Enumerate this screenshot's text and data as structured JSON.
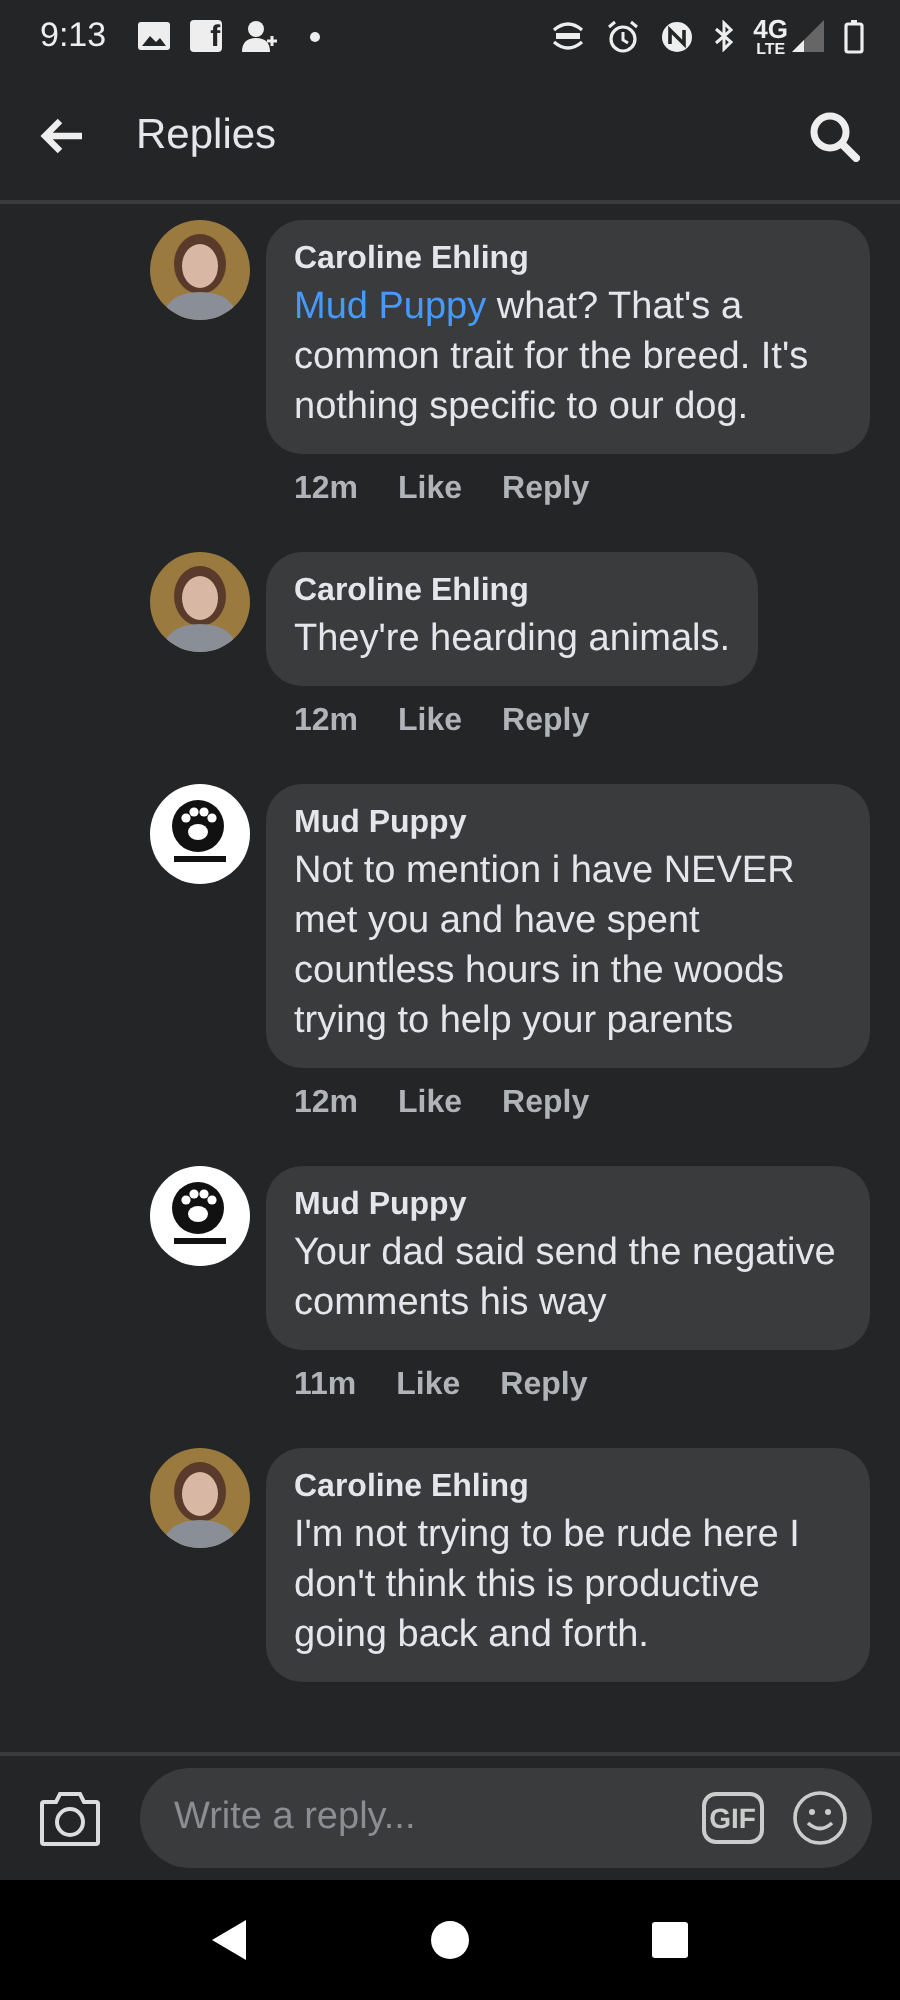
{
  "status_bar": {
    "time": "9:13",
    "notification_letter": "f",
    "network": "4G",
    "network_sub": "LTE"
  },
  "header": {
    "title": "Replies"
  },
  "comments": [
    {
      "author": "Caroline Ehling",
      "kind": "person",
      "mention": "Mud Puppy",
      "text": " what? That's a common trait for the breed. It's nothing specific to our dog.",
      "time": "12m",
      "like": "Like",
      "reply": "Reply"
    },
    {
      "author": "Caroline Ehling",
      "kind": "person",
      "text": "They're hearding animals.",
      "time": "12m",
      "like": "Like",
      "reply": "Reply"
    },
    {
      "author": "Mud Puppy",
      "kind": "paw",
      "text": "Not to mention i have NEVER met you and have spent countless hours in the woods trying to help your parents",
      "time": "12m",
      "like": "Like",
      "reply": "Reply"
    },
    {
      "author": "Mud Puppy",
      "kind": "paw",
      "text": "Your dad said send the negative comments  his way",
      "time": "11m",
      "like": "Like",
      "reply": "Reply"
    },
    {
      "author": "Caroline Ehling",
      "kind": "person",
      "text": "I'm not trying to be rude here I don't think this is productive going back and forth."
    }
  ],
  "composer": {
    "placeholder": "Write a reply...",
    "gif": "GIF"
  }
}
